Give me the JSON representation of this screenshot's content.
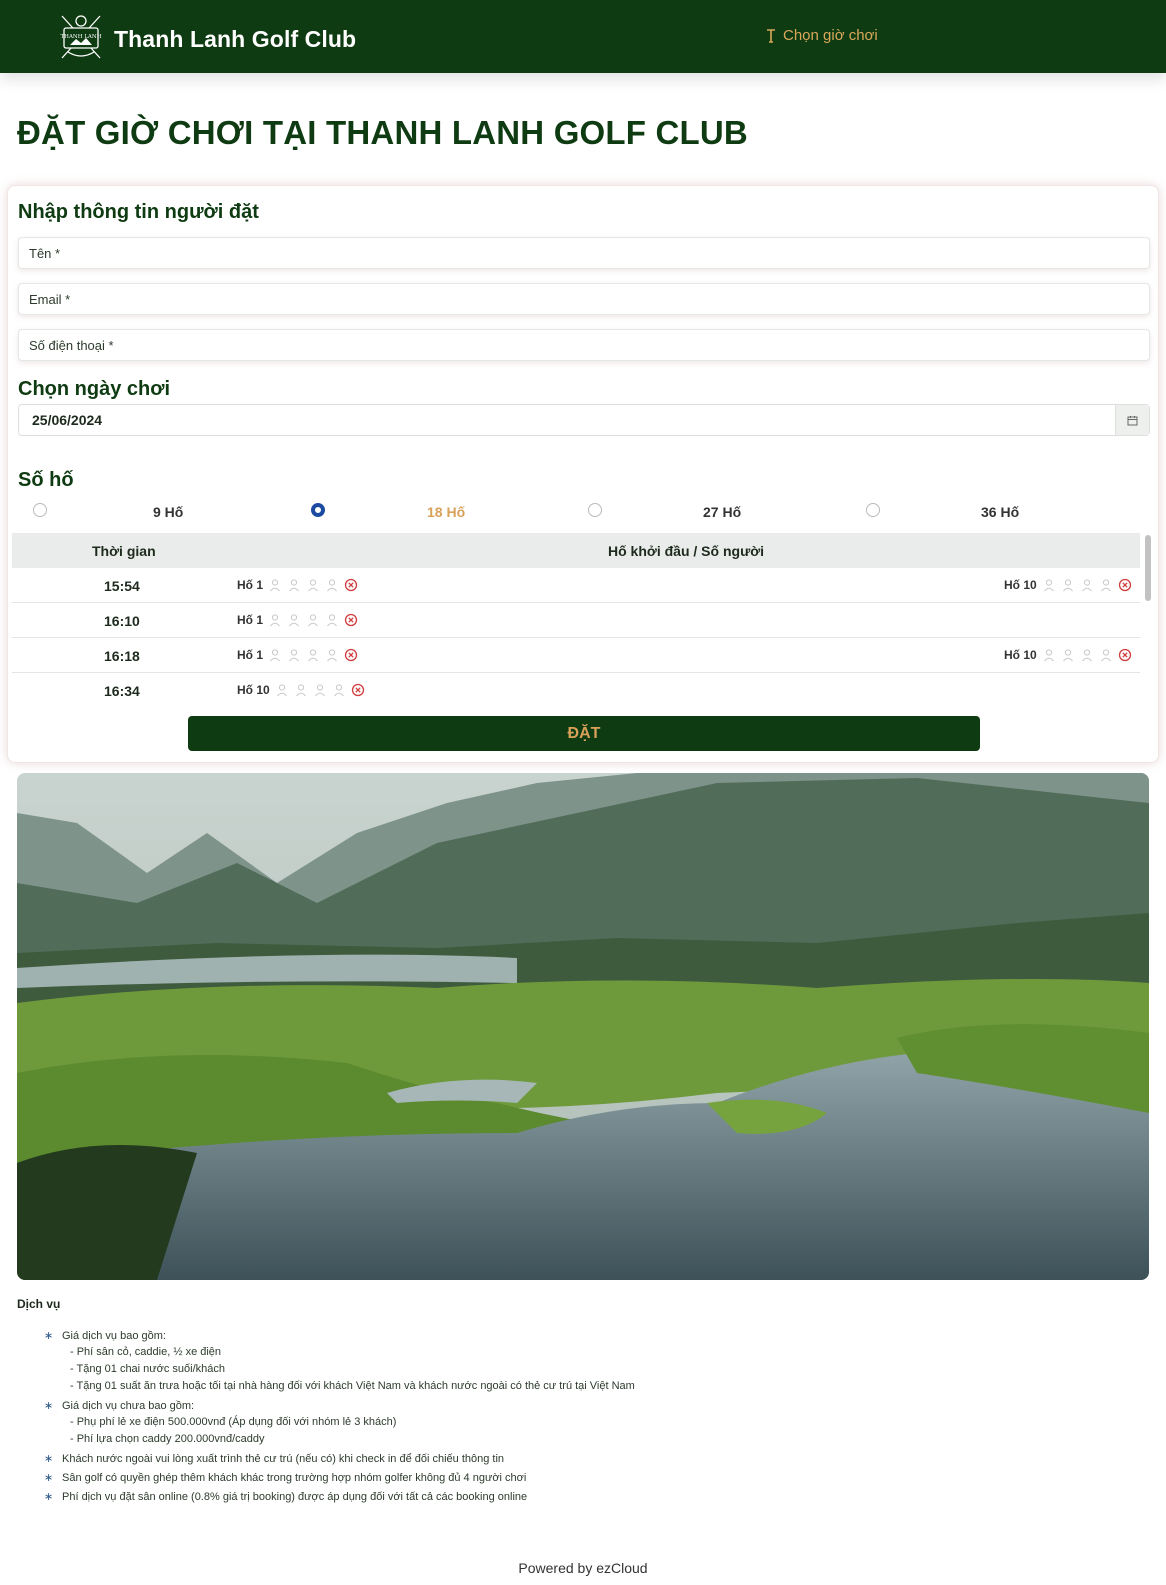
{
  "header": {
    "brand": "Thanh Lanh Golf Club",
    "nav_link": "Chọn giờ chơi"
  },
  "page": {
    "title": "ĐẶT GIỜ CHƠI TẠI THANH LANH GOLF CLUB"
  },
  "booker": {
    "heading": "Nhập thông tin người đặt",
    "name_placeholder": "Tên *",
    "email_placeholder": "Email *",
    "phone_placeholder": "Số điện thoại *"
  },
  "date": {
    "heading": "Chọn ngày chơi",
    "value": "25/06/2024"
  },
  "holes": {
    "heading": "Số hố",
    "options": [
      {
        "label": "9 Hố",
        "selected": false
      },
      {
        "label": "18 Hố",
        "selected": true
      },
      {
        "label": "27 Hố",
        "selected": false
      },
      {
        "label": "36 Hố",
        "selected": false
      }
    ]
  },
  "tee_table": {
    "col_time": "Thời gian",
    "col_start": "Hố khởi đầu / Số người",
    "rows": [
      {
        "time": "15:54",
        "left": "Hố 1",
        "right": "Hố 10"
      },
      {
        "time": "16:10",
        "left": "Hố 1",
        "right": ""
      },
      {
        "time": "16:18",
        "left": "Hố 1",
        "right": "Hố 10"
      },
      {
        "time": "16:34",
        "left": "Hố 10",
        "right": ""
      }
    ]
  },
  "submit_label": "ĐẶT",
  "services": {
    "title": "Dịch vụ",
    "included_title": "Giá dịch vụ bao gồm:",
    "included": [
      "- Phí sân cỏ, caddie, ½ xe điện",
      "- Tặng 01 chai nước suối/khách",
      "- Tặng 01 suất ăn trưa hoặc tối tại nhà hàng đối với khách Việt Nam và khách nước ngoài có thẻ cư trú tại Việt Nam"
    ],
    "excluded_title": "Giá dịch vụ chưa bao gồm:",
    "excluded": [
      "- Phụ phí lẻ xe điện 500.000vnđ (Áp dụng đối với nhóm lẻ 3 khách)",
      "- Phí lựa chọn caddy 200.000vnđ/caddy"
    ],
    "notes": [
      "Khách nước ngoài vui lòng xuất trình thẻ cư trú (nếu có) khi check in để đối chiếu thông tin",
      "Sân golf có quyền ghép thêm khách khác trong trường hợp nhóm golfer không đủ 4 người chơi",
      "Phí dịch vụ đặt sân online (0.8% giá trị booking) được áp dụng đối với tất cả các booking online"
    ]
  },
  "footer": "Powered by ezCloud",
  "colors": {
    "brand_green": "#0f3b12",
    "accent_gold": "#d9a05a",
    "radio_blue": "#1b4aa0",
    "cancel_red": "#d23c3c"
  },
  "icons": {
    "logo": "golf-club-crest-icon",
    "nav": "golf-tee-icon",
    "calendar": "calendar-icon",
    "player": "person-outline-icon",
    "cancel": "circle-x-icon"
  }
}
